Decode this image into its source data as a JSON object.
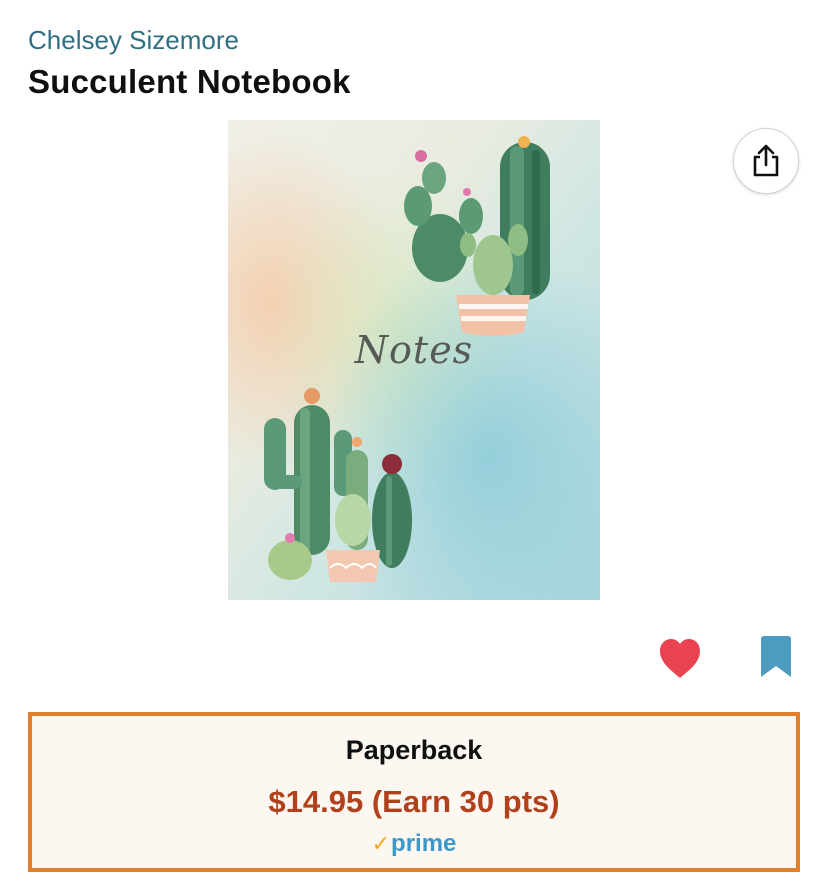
{
  "product": {
    "author": "Chelsey Sizemore",
    "title": "Succulent Notebook",
    "cover": {
      "text": "Notes",
      "alt_subject": "watercolor cacti notebook cover"
    }
  },
  "actions": {
    "share_icon": "share-icon",
    "favorite_icon": "heart-icon",
    "favorite_color": "#e8434f",
    "save_icon": "bookmark-icon",
    "save_color": "#4d9bbf"
  },
  "format": {
    "name": "Paperback",
    "price": "$14.95 (Earn 30 pts)",
    "price_color": "#b1411b",
    "prime_check": "✓",
    "prime_label": "prime",
    "border_color": "#e07f2c",
    "background_color": "#fdf7f1"
  }
}
